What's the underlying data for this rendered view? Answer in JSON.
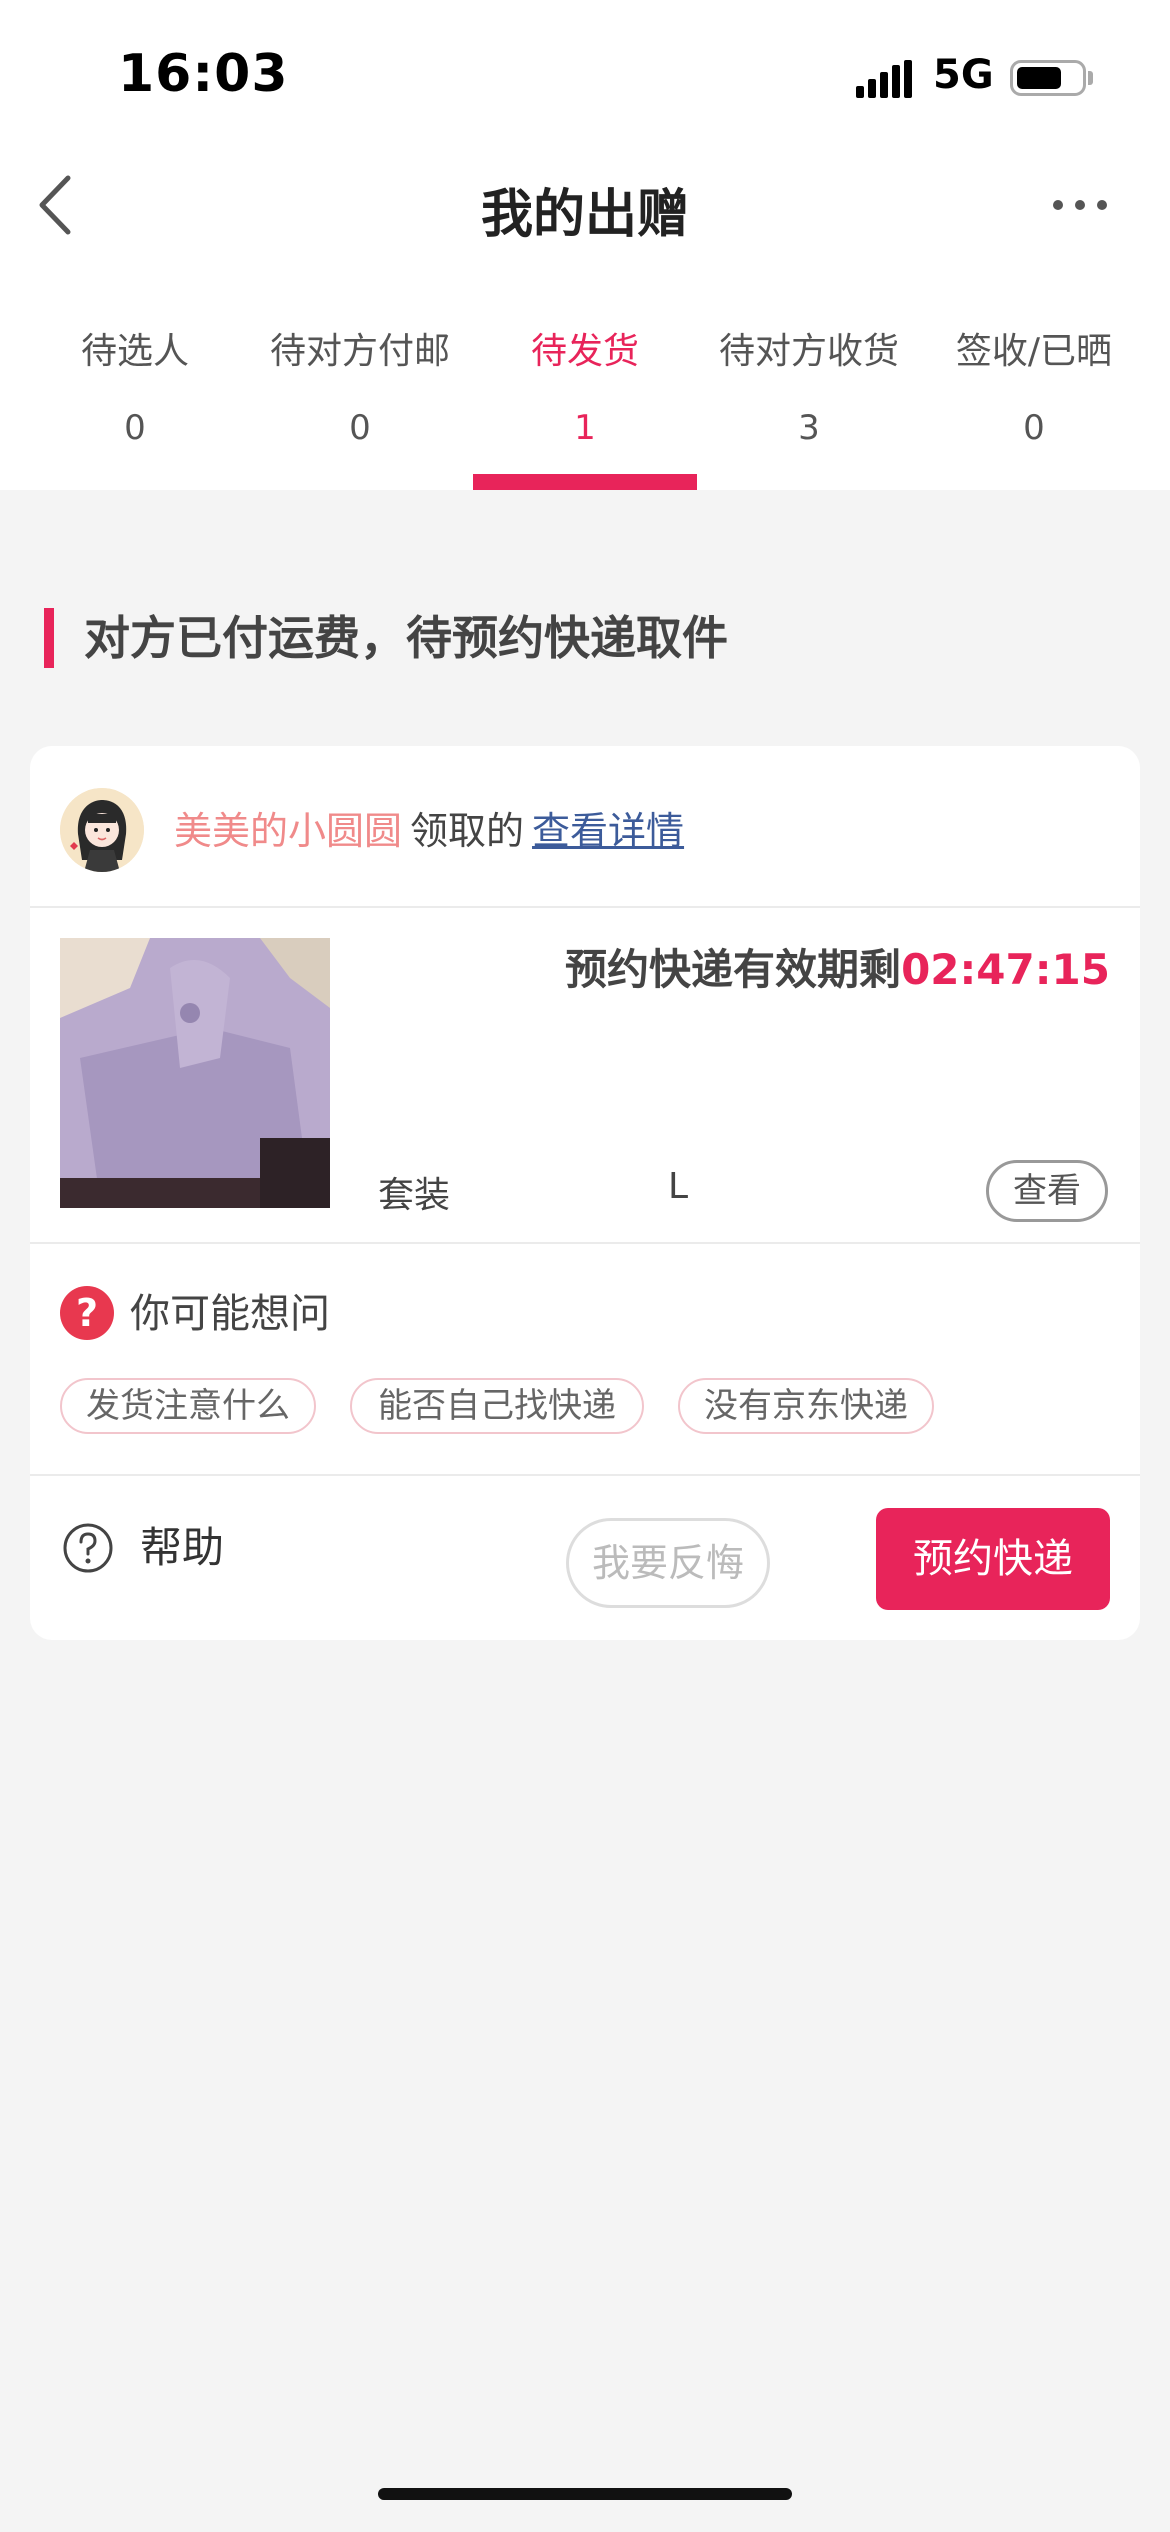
{
  "status_bar": {
    "time": "16:03",
    "network": "5G"
  },
  "nav": {
    "title": "我的出赠"
  },
  "tabs": [
    {
      "label": "待选人",
      "count": "0"
    },
    {
      "label": "待对方付邮",
      "count": "0"
    },
    {
      "label": "待发货",
      "count": "1"
    },
    {
      "label": "待对方收货",
      "count": "3"
    },
    {
      "label": "签收/已晒",
      "count": "0"
    }
  ],
  "active_tab": "待发货",
  "section": {
    "title": "对方已付运费，待预约快递取件"
  },
  "order": {
    "nickname": "美美的小圆圆",
    "claimed_text": "领取的",
    "detail_link": "查看详情",
    "countdown_label": "预约快递有效期剩",
    "countdown_time": "02:47:15",
    "item_type": "套装",
    "item_size": "L",
    "view_button": "查看"
  },
  "faq": {
    "title": "你可能想问",
    "chips": [
      "发货注意什么",
      "能否自己找快递",
      "没有京东快递"
    ]
  },
  "actions": {
    "help": "帮助",
    "regret": "我要反悔",
    "book": "预约快递"
  },
  "colors": {
    "accent": "#e8245a",
    "nickname": "#f08a8a",
    "link": "#3c5b9a",
    "background": "#f4f4f4"
  }
}
